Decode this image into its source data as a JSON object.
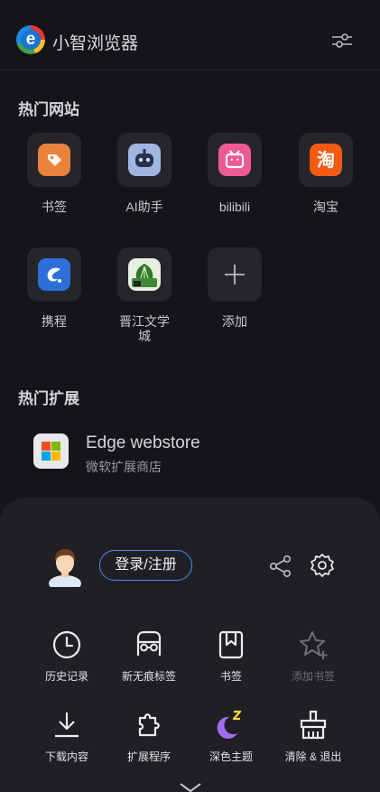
{
  "header": {
    "title": "小智浏览器",
    "logo_letter": "e"
  },
  "hot_sites": {
    "title": "热门网站",
    "items": [
      {
        "label": "书签",
        "icon": "bookmark-tag-icon",
        "color": "#e9823b"
      },
      {
        "label": "AI助手",
        "icon": "robot-icon",
        "color": "#9fb7e0"
      },
      {
        "label": "bilibili",
        "icon": "bilibili-tv-icon",
        "color": "#ef5a93"
      },
      {
        "label": "淘宝",
        "icon": "taobao-icon",
        "color": "#f45a12",
        "glyph": "淘"
      },
      {
        "label": "携程",
        "icon": "ctrip-dolphin-icon",
        "color": "#2c6fd9"
      },
      {
        "label": "晋江文学城",
        "icon": "jinjiang-icon",
        "color": "#3f8a37"
      },
      {
        "label": "添加",
        "icon": "plus-icon"
      }
    ]
  },
  "hot_extensions": {
    "title": "热门扩展",
    "items": [
      {
        "name": "Edge webstore",
        "subtitle": "微软扩展商店",
        "icon": "microsoft-store-icon"
      }
    ]
  },
  "sheet": {
    "login_label": "登录/注册",
    "menu": [
      {
        "label": "历史记录",
        "icon": "history-clock-icon"
      },
      {
        "label": "新无痕标签",
        "icon": "incognito-icon"
      },
      {
        "label": "书签",
        "icon": "bookmark-icon"
      },
      {
        "label": "添加书签",
        "icon": "star-add-icon",
        "disabled": true
      },
      {
        "label": "下载内容",
        "icon": "download-icon"
      },
      {
        "label": "扩展程序",
        "icon": "puzzle-icon"
      },
      {
        "label": "深色主题",
        "icon": "moon-icon",
        "color": "#a26bf5"
      },
      {
        "label": "清除 & 退出",
        "icon": "broom-icon"
      }
    ]
  },
  "colors": {
    "accent": "#4a8cff",
    "background": "#141419",
    "sheet": "#202024"
  }
}
